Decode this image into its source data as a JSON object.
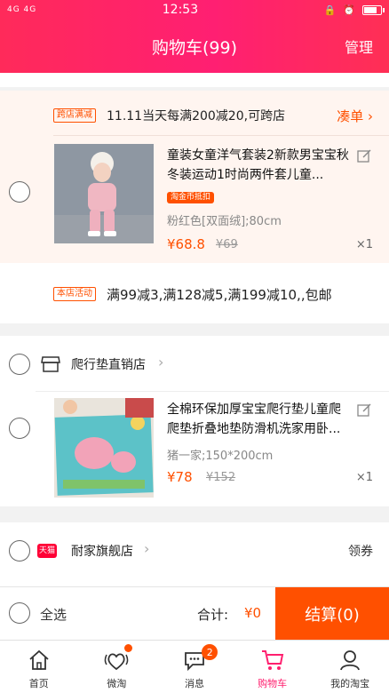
{
  "status_bar": {
    "network": "4G 4G",
    "time": "12:53"
  },
  "header": {
    "title": "购物车(99)",
    "manage": "管理"
  },
  "group1": {
    "promo_tag": "跨店满减",
    "promo_text": "11.11当天每满200减20,可跨店",
    "collect_label": "凑单",
    "item": {
      "title": "童装女童洋气套装2新款男宝宝秋冬装运动1时尚两件套儿童...",
      "tag": "淘金币抵扣",
      "sku": "粉红色[双面绒];80cm",
      "price": "¥68.8",
      "old_price": "¥69",
      "qty": "×1"
    },
    "shop_promo_tag": "本店活动",
    "shop_promo_text": "满99减3,满128减5,满199减10,,包邮"
  },
  "group2": {
    "shop_name": "爬行垫直销店",
    "item": {
      "title": "全棉环保加厚宝宝爬行垫儿童爬爬垫折叠地垫防滑机洗家用卧...",
      "sku": "猪一家;150*200cm",
      "price": "¥78",
      "old_price": "¥152",
      "qty": "×1"
    }
  },
  "group3": {
    "shop_logo": "天猫",
    "shop_name": "耐家旗舰店",
    "coupon": "领券"
  },
  "checkout": {
    "select_all": "全选",
    "total_label": "合计:",
    "total_value": "¥0",
    "button": "结算(0)"
  },
  "tabbar": {
    "items": [
      {
        "label": "首页",
        "icon": "home-icon"
      },
      {
        "label": "微淘",
        "icon": "weitao-icon"
      },
      {
        "label": "消息",
        "icon": "message-icon",
        "badge": "2"
      },
      {
        "label": "购物车",
        "icon": "cart-icon"
      },
      {
        "label": "我的淘宝",
        "icon": "profile-icon"
      }
    ]
  },
  "colors": {
    "header_gradient_start": "#ff2a5a",
    "accent": "#ff5000",
    "active_tab": "#ff1f6e"
  }
}
